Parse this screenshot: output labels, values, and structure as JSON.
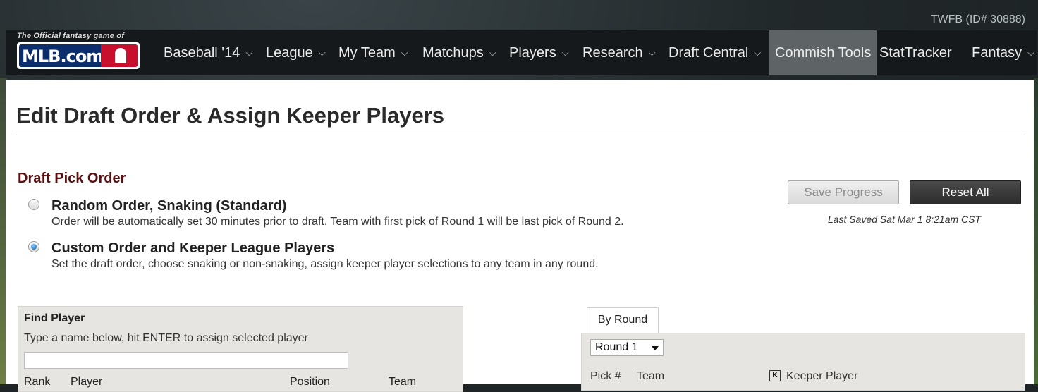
{
  "user": {
    "id_label": "TWFB (ID# 30888)"
  },
  "logo": {
    "tagline": "The Official fantasy game of",
    "text": "MLB.com"
  },
  "nav": {
    "items": [
      {
        "label": "Baseball '14",
        "has_dropdown": true
      },
      {
        "label": "League",
        "has_dropdown": true
      },
      {
        "label": "My Team",
        "has_dropdown": true
      },
      {
        "label": "Matchups",
        "has_dropdown": true
      },
      {
        "label": "Players",
        "has_dropdown": true
      },
      {
        "label": "Research",
        "has_dropdown": true
      },
      {
        "label": "Draft Central",
        "has_dropdown": true
      },
      {
        "label": "Commish Tools",
        "has_dropdown": false,
        "active": true
      },
      {
        "label": "StatTracker",
        "has_dropdown": false
      },
      {
        "label": "Fantasy",
        "has_dropdown": true
      }
    ],
    "chevron": "⌵"
  },
  "page": {
    "title": "Edit Draft Order & Assign Keeper Players"
  },
  "draft_order": {
    "section_title": "Draft Pick Order",
    "options": [
      {
        "title": "Random Order, Snaking (Standard)",
        "desc": "Order will be automatically set 30 minutes prior to draft. Team with first pick of Round 1 will be last pick of Round 2.",
        "checked": false
      },
      {
        "title": "Custom Order and Keeper League Players",
        "desc": "Set the draft order, choose snaking or non-snaking, assign keeper player selections to any team in any round.",
        "checked": true
      }
    ]
  },
  "actions": {
    "save_label": "Save Progress",
    "reset_label": "Reset All",
    "last_saved": "Last Saved Sat Mar 1 8:21am CST"
  },
  "find_player": {
    "title": "Find Player",
    "hint": "Type a name below, hit ENTER to assign selected player",
    "input_value": "",
    "columns": [
      "Rank",
      "Player",
      "Position",
      "Team"
    ]
  },
  "by_round": {
    "tab_label": "By Round",
    "selected_round": "Round 1",
    "columns": {
      "pick": "Pick #",
      "team": "Team",
      "keeper_icon": "K",
      "keeper": "Keeper Player"
    }
  },
  "colors": {
    "nav_bg": "#16191b",
    "active_nav": "#5e6466",
    "section_title": "#5a1010",
    "mlb_blue": "#0b2d6b",
    "mlb_red": "#c8102e"
  }
}
